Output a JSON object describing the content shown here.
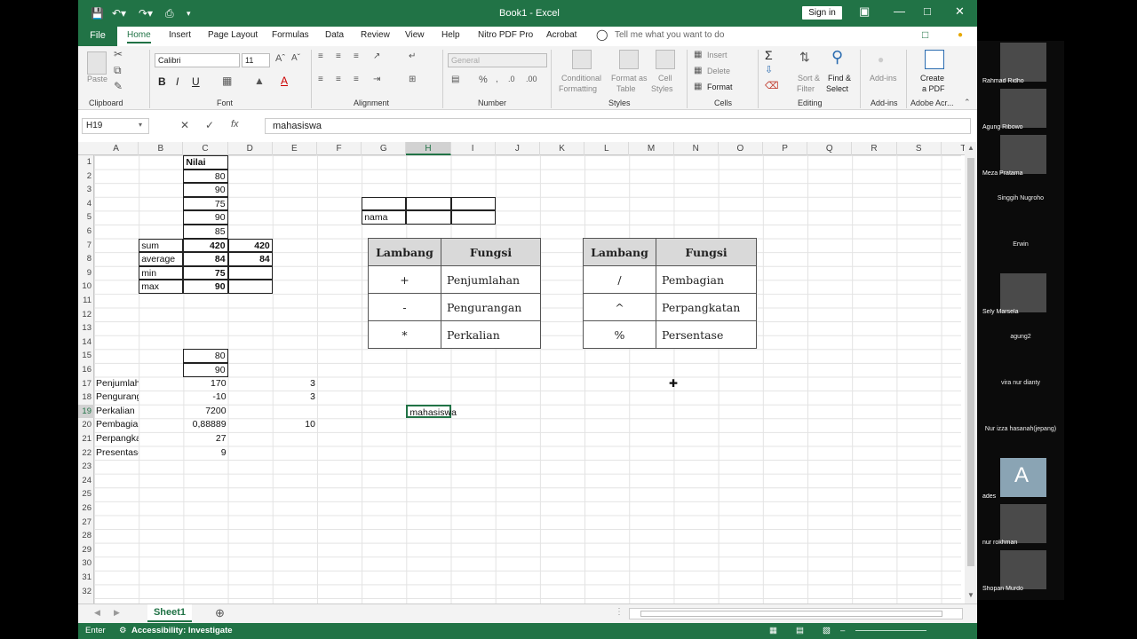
{
  "app": {
    "title": "Book1 - Excel",
    "sign_in": "Sign in"
  },
  "tabs": [
    "File",
    "Home",
    "Insert",
    "Page Layout",
    "Formulas",
    "Data",
    "Review",
    "View",
    "Help",
    "Nitro PDF Pro",
    "Acrobat"
  ],
  "tell_me": "Tell me what you want to do",
  "ribbon": {
    "clipboard": {
      "label": "Clipboard",
      "paste": "Paste"
    },
    "font": {
      "label": "Font",
      "name": "Calibri",
      "size": "11"
    },
    "alignment": {
      "label": "Alignment"
    },
    "number": {
      "label": "Number",
      "format": "General"
    },
    "styles": {
      "label": "Styles",
      "conditional": "Conditional",
      "formatting": "Formatting",
      "format_as": "Format as",
      "table": "Table",
      "cell": "Cell",
      "cell_styles": "Styles"
    },
    "cells": {
      "label": "Cells",
      "insert": "Insert",
      "delete": "Delete",
      "format": "Format"
    },
    "editing": {
      "label": "Editing",
      "sort": "Sort &",
      "filter": "Filter",
      "find": "Find &",
      "select": "Select"
    },
    "addins": {
      "label": "Add-ins",
      "addins": "Add-ins"
    },
    "adobe": {
      "label": "Adobe Acr...",
      "create": "Create",
      "pdf": "a PDF"
    }
  },
  "formula_bar": {
    "name_box": "H19",
    "value": "mahasiswa"
  },
  "columns": [
    "A",
    "B",
    "C",
    "D",
    "E",
    "F",
    "G",
    "H",
    "I",
    "J",
    "K",
    "L",
    "M",
    "N",
    "O",
    "P",
    "Q",
    "R",
    "S",
    "T"
  ],
  "rows": [
    "1",
    "2",
    "3",
    "4",
    "5",
    "6",
    "7",
    "8",
    "9",
    "10",
    "11",
    "12",
    "13",
    "14",
    "15",
    "16",
    "17",
    "18",
    "19",
    "20",
    "21",
    "22",
    "23",
    "24",
    "25",
    "26",
    "27",
    "28",
    "29",
    "30",
    "31",
    "32"
  ],
  "cells": {
    "C1": "Nilai",
    "C2": "80",
    "C3": "90",
    "C4": "75",
    "C5": "90",
    "C6": "85",
    "B7": "sum",
    "C7": "420",
    "D7": "420",
    "B8": "average",
    "C8": "84",
    "D8": "84",
    "B9": "min",
    "C9": "75",
    "B10": "max",
    "C10": "90",
    "G5": "nama",
    "C15": "80",
    "C16": "90",
    "A17": "Penjumlahan",
    "C17": "170",
    "E17": "3",
    "A18": "Pengurangan",
    "C18": "-10",
    "E18": "3",
    "A19": "Perkalian",
    "C19": "7200",
    "A20": "Pembagian",
    "C20": "0,88889",
    "E20": "10",
    "A21": "Perpangkatan",
    "C21": "27",
    "A22": "Presentase",
    "C22": "9",
    "H19": "mahasiswa"
  },
  "table1": {
    "headers": [
      "Lambang",
      "Fungsi"
    ],
    "rows": [
      [
        "+",
        "Penjumlahan"
      ],
      [
        "-",
        "Pengurangan"
      ],
      [
        "*",
        "Perkalian"
      ]
    ]
  },
  "table2": {
    "headers": [
      "Lambang",
      "Fungsi"
    ],
    "rows": [
      [
        "/",
        "Pembagian"
      ],
      [
        "^",
        "Perpangkatan"
      ],
      [
        "%",
        "Persentase"
      ]
    ]
  },
  "sheet_tab": "Sheet1",
  "status": {
    "mode": "Enter",
    "accessibility": "Accessibility: Investigate"
  },
  "participants": [
    "Rahmad Ridho",
    "Agung Ribowo",
    "Meza Pratama",
    "Singgih Nugroho",
    "Erwin",
    "Sely Marsela",
    "agung2",
    "vira nur dianty",
    "Nur izza hasanah(jepang)",
    "ades",
    "nur rokhman",
    "Shopan Murdo"
  ],
  "avatar_letter": "A",
  "colors": {
    "excel_green": "#217346",
    "header_gray": "#d9d9d9"
  }
}
